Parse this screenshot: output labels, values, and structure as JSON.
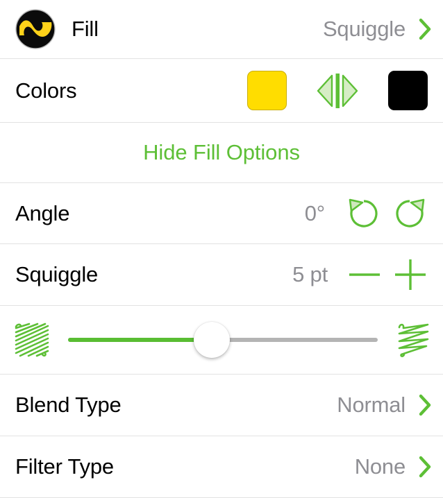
{
  "header": {
    "icon_name": "squiggle-fill-icon",
    "title": "Fill",
    "value": "Squiggle",
    "chevron": "chevron-right-icon"
  },
  "colors": {
    "label": "Colors",
    "front_swatch_color": "#FFDD00",
    "back_swatch_color": "#000000",
    "swap_icon": "swap-colors-icon"
  },
  "hide_options": {
    "label": "Hide Fill Options"
  },
  "angle": {
    "label": "Angle",
    "value": "0°",
    "rotate_ccw_icon": "rotate-counterclockwise-icon",
    "rotate_cw_icon": "rotate-clockwise-icon"
  },
  "squiggle": {
    "label": "Squiggle",
    "value": "5 pt",
    "minus_icon": "minus-icon",
    "plus_icon": "plus-icon"
  },
  "slider": {
    "min_icon": "dense-squiggle-icon",
    "max_icon": "sparse-squiggle-icon",
    "thumb_icon": "slider-thumb"
  },
  "blend_type": {
    "label": "Blend Type",
    "value": "Normal",
    "chevron": "chevron-right-icon"
  },
  "filter_type": {
    "label": "Filter Type",
    "value": "None",
    "chevron": "chevron-right-icon"
  },
  "colors_palette": {
    "accent_green": "#5DBF36",
    "track_green": "#59BD33",
    "value_gray": "#8E8E93",
    "divider": "#E2E2E2",
    "label_black": "#000000",
    "yellow": "#FFDD00"
  }
}
